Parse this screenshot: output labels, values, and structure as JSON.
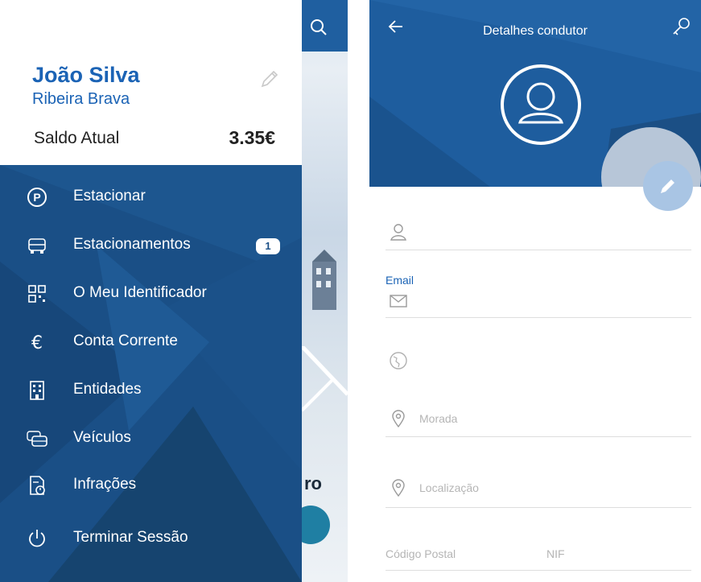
{
  "left": {
    "drawer": {
      "user_name": "João Silva",
      "user_location": "Ribeira Brava",
      "balance_label": "Saldo Atual",
      "balance_value": "3.35€",
      "menu": [
        {
          "label": "Estacionar",
          "icon": "parking-icon"
        },
        {
          "label": "Estacionamentos",
          "icon": "car-front-icon",
          "badge": "1"
        },
        {
          "label": "O Meu Identificador",
          "icon": "qr-code-icon"
        },
        {
          "label": "Conta Corrente",
          "icon": "euro-icon"
        },
        {
          "label": "Entidades",
          "icon": "building-icon"
        },
        {
          "label": "Veículos",
          "icon": "cars-icon"
        },
        {
          "label": "Infrações",
          "icon": "document-clock-icon"
        },
        {
          "label": "Terminar Sessão",
          "icon": "power-icon"
        }
      ]
    },
    "map_partial_label": "ro"
  },
  "right": {
    "title": "Detalhes condutor",
    "fields": {
      "email_label": "Email",
      "address_placeholder": "Morada",
      "location_placeholder": "Localização",
      "postal_code_label": "Código Postal",
      "nif_label": "NIF"
    }
  },
  "colors": {
    "brand_blue": "#1b63b5",
    "drawer_bg": "#1a4f86",
    "header_bg": "#1e5d9e",
    "fab_light": "#a9c5e4"
  }
}
